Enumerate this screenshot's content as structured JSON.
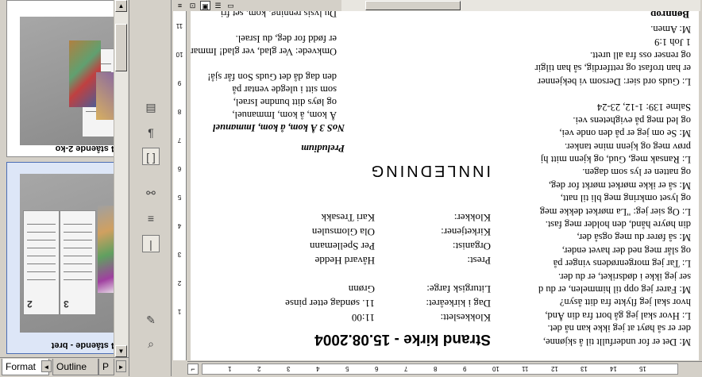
{
  "left_pane": {
    "thumbnails": [
      {
        "caption": "A4 stående 2-ko",
        "selected": false
      },
      {
        "caption": "A4 stående - bret",
        "selected": true
      }
    ],
    "tabs": [
      "Format",
      "Outline",
      "P"
    ]
  },
  "document": {
    "title": "Strand kirke - 15.08.2004",
    "heading": "INNLEDNING",
    "fields": [
      {
        "label": "Klokkeslett:",
        "value": "11:00"
      },
      {
        "label": "Dag i kirkeåret:",
        "value": "11. søndag etter pinse"
      },
      {
        "label": "Liturgisk farge:",
        "value": "Grønn"
      },
      {
        "label": "Prest:",
        "value": "Håvard Hedde"
      },
      {
        "label": "Organist:",
        "value": "Per Spellemann"
      },
      {
        "label": "Kirketjener:",
        "value": "Ola Glomsulen"
      },
      {
        "label": "Klokker:",
        "value": "Kari Tresakk"
      }
    ],
    "preludium_label": "Preludium",
    "hymn_title": "NoS 3 Å kom, å kom, Immanuel",
    "hymn_lines": [
      "Å kom, å kom, Immanuel,",
      "og løys ditt bundne Israel,",
      "som sitt i ulegde ventar på",
      "den dag då det Guds Son får sjå!",
      "",
      "Omkvede: Ver glad, ver glad! Immanuel",
      "er fødd for deg, du Israel.",
      "",
      "Du lysis renning, kom, set fri"
    ],
    "right_heading": "Bønnrop",
    "right_lines": [
      "M: Amen.",
      "1 Joh 1:9",
      "og renser oss fra all urett.",
      "er han trofast og rettferdig, så han tilgir",
      "L: Guds ord sier: Dersom vi bekjenner",
      "",
      "Salme 139: 1-12, 23-24",
      "og led meg på evighetens vei.",
      "M: Se om jeg er på den onde vei,",
      "prøv meg og kjenn mine tanker.",
      "L: Ransak meg, Gud, og kjenn mitt hj",
      "og natten er lys som dagen.",
      "M: så er ikke mørket mørkt for deg,",
      "og lyset omkring meg bli til natt,",
      "L: Og sier jeg: \"La mørket dekke meg",
      "din høyre hånd, den holder meg fast.",
      "M: så fører du meg også der,",
      "og slår meg ned der havet ender,",
      "L: Tar jeg morgenrødens vinger på",
      "ser jeg ikke i dødsriket, er du der.",
      "M: Farer jeg opp til himmelen, er du d",
      "hvor skal jeg flykte fra ditt åsyn?",
      "L: Hvor skal jeg gå bort fra din Ånd,",
      "der er så høyt at jeg ikke kan nå det.",
      "M: Det er for underfullt til å skjønne,"
    ]
  },
  "ruler": {
    "v_numbers": [
      "11",
      "10",
      "9",
      "8",
      "7",
      "6",
      "5",
      "4",
      "3",
      "2",
      "1"
    ],
    "h_numbers": [
      "1",
      "2",
      "3",
      "4",
      "5",
      "6",
      "7",
      "8",
      "9",
      "10",
      "11",
      "12",
      "13",
      "14",
      "15"
    ]
  },
  "colors": {
    "accent": "#4c6eb5",
    "selected_bg": "#dde6f7",
    "chrome": "#d4d0c8"
  }
}
